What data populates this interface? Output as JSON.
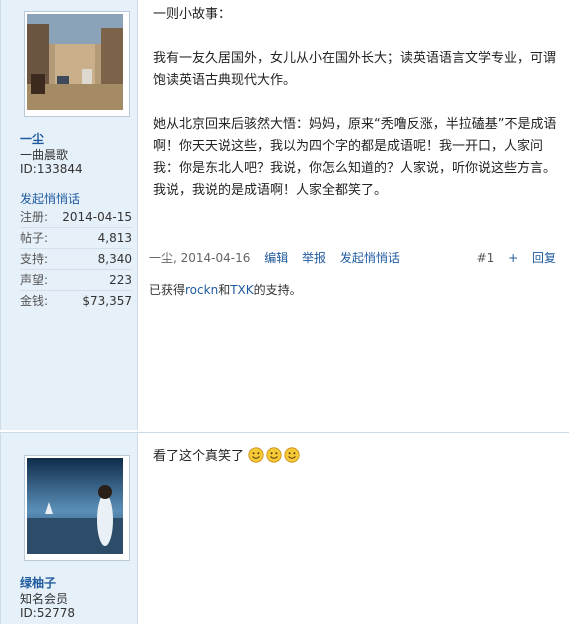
{
  "post1": {
    "user": {
      "name": "一尘",
      "group": "一曲晨歌",
      "id": "ID:133844",
      "pm": "发起悄悄话"
    },
    "stats": [
      {
        "k": "注册:",
        "v": "2014-04-15"
      },
      {
        "k": "帖子:",
        "v": "4,813"
      },
      {
        "k": "支持:",
        "v": "8,340"
      },
      {
        "k": "声望:",
        "v": "223"
      },
      {
        "k": "金钱:",
        "v": "$73,357"
      }
    ],
    "message": {
      "line1": "一则小故事：",
      "para2": "我有一友久居国外，女儿从小在国外长大；读英语语言文学专业，可谓饱读英语古典现代大作。",
      "para3": "她从北京回来后骇然大悟：妈妈，原来“秃噜反涨，半拉磕基”不是成语啊！你天天说这些，我以为四个字的都是成语呢！我一开口，人家问我：你是东北人吧？我说，你怎么知道的？人家说，听你说这些方言。我说，我说的是成语啊！人家全都笑了。"
    },
    "footer": {
      "author_date": "一尘, 2014-04-16",
      "edit": "编辑",
      "report": "举报",
      "pm": "发起悄悄话",
      "floor": "#1",
      "plus": "+",
      "reply": "回复"
    },
    "support": {
      "prefix": "已获得",
      "u1": "rockn",
      "and": "和",
      "u2": "TXK",
      "suffix": "的支持。"
    }
  },
  "post2": {
    "user": {
      "name": "绿柚子",
      "group": "知名会员",
      "id": "ID:52778"
    },
    "message": "看了这个真笑了"
  },
  "colors": {
    "link": "#1f5a9e",
    "sidebar": "#e6f0f9",
    "border": "#cddbe8"
  }
}
